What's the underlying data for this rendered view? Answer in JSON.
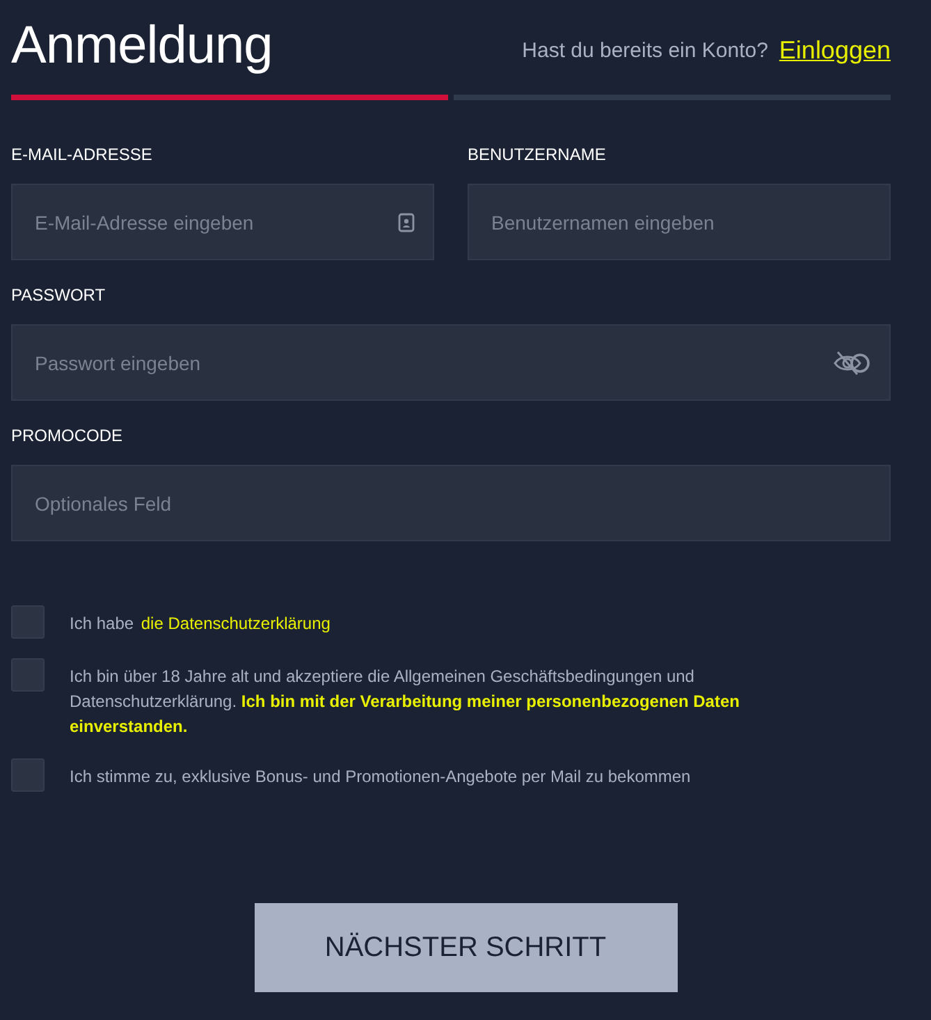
{
  "header": {
    "title": "Anmeldung",
    "prompt": "Hast du bereits ein Konto?",
    "login_link": "Einloggen"
  },
  "steps": [
    {
      "selected": true
    },
    {
      "selected": false
    }
  ],
  "fields": [
    {
      "label": "E-MAIL-ADRESSE",
      "placeholder": "E-Mail-Adresse eingeben",
      "kind": "email"
    },
    {
      "label": "BENUTZERNAME",
      "placeholder": "Benutzernamen eingeben",
      "kind": "text"
    },
    {
      "label": "PASSWORT",
      "placeholder": "Passwort eingeben",
      "kind": "password"
    },
    {
      "label": "PROMOCODE",
      "placeholder": "Optionales Feld",
      "kind": "text"
    }
  ],
  "consents": [
    {
      "checked": false,
      "text": "Ich habe ",
      "link": "die Datenschutzerklärung"
    },
    {
      "checked": false,
      "text": "Ich bin über 18 Jahre alt und akzeptiere die Allgemeinen Geschäftsbedingungen und Datenschutzerklärung. ",
      "note": "Ich bin mit der Verarbeitung meiner personenbezogenen Daten einverstanden."
    },
    {
      "checked": false,
      "text": "Ich stimme zu, exklusive Bonus- und Promotionen-Angebote per Mail zu bekommen"
    }
  ],
  "submit": "NÄCHSTER SCHRITT"
}
